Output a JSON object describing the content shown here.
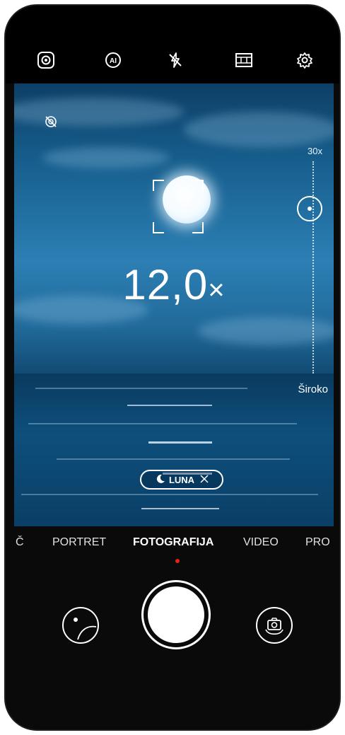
{
  "top_bar": {
    "icons": [
      "aperture-icon",
      "ai-icon",
      "flash-off-icon",
      "filter-icon",
      "settings-icon"
    ]
  },
  "viewfinder": {
    "lock_icon": "moving-picture-off-icon",
    "zoom": {
      "value": "12,0",
      "unit": "×",
      "max_label": "30x",
      "min_label": "Široko",
      "level": 12.0
    },
    "scene_chip": {
      "label": "LUNA",
      "icon": "moon-icon",
      "close_icon": "close-icon"
    }
  },
  "modes": {
    "items": [
      {
        "label": "Č"
      },
      {
        "label": "PORTRET"
      },
      {
        "label": "FOTOGRAFIJA"
      },
      {
        "label": "VIDEO"
      },
      {
        "label": "PRO"
      }
    ],
    "active": "FOTOGRAFIJA",
    "indicator_color": "#e2231a"
  },
  "bottom_controls": {
    "gallery_icon": "gallery-thumbnail-icon",
    "shutter_icon": "shutter-icon",
    "switch_icon": "switch-camera-icon"
  }
}
